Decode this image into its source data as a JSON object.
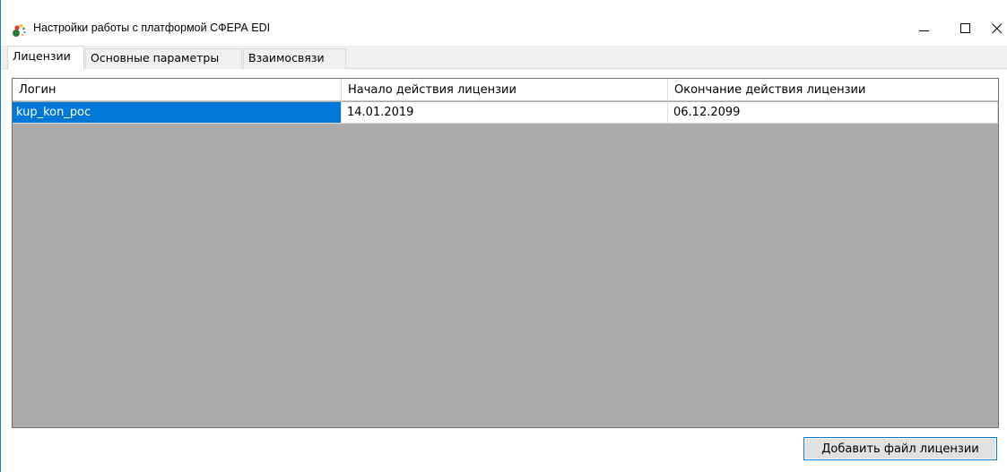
{
  "window": {
    "title": "Настройки работы с платформой СФЕРА EDI"
  },
  "tabs": [
    {
      "label": "Лицензии",
      "active": true
    },
    {
      "label": "Основные параметры",
      "active": false
    },
    {
      "label": "Взаимосвязи",
      "active": false
    }
  ],
  "licenses_table": {
    "columns": [
      "Логин",
      "Начало действия лицензии",
      "Окончание действия лицензии"
    ],
    "rows": [
      {
        "login": "kup_kon_poc",
        "start": "14.01.2019",
        "end": "06.12.2099"
      }
    ]
  },
  "actions": {
    "add_license_label": "Добавить файл лицензии"
  },
  "colors": {
    "selection": "#0078d7",
    "grid_background": "#ababab",
    "window_border": "#1979ca"
  },
  "icons": {
    "app": "sfera-edi-logo-icon",
    "minimize": "minimize-icon",
    "maximize": "maximize-icon",
    "close": "close-icon"
  }
}
